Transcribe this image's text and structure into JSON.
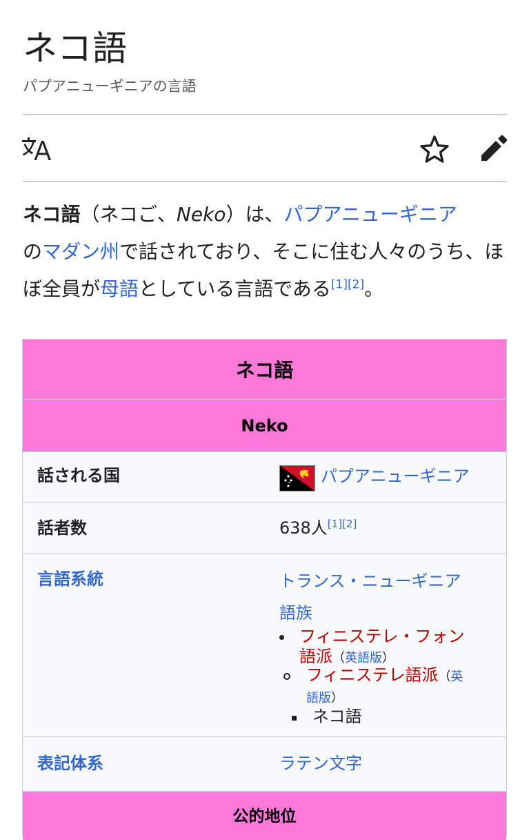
{
  "header": {
    "title": "ネコ語",
    "subtitle": "パプアニューギニアの言語"
  },
  "toolbar": {
    "icons": [
      "language-icon",
      "star-icon",
      "edit-pencil-icon"
    ]
  },
  "lead": {
    "term": "ネコ語",
    "reading": "（ネコご、",
    "romanized": "Neko",
    "after_romanized": "）は、",
    "link_country": "パプアニューギニア",
    "text_no": "の",
    "link_province": "マダン州",
    "text_mid": "で話されており、そこに住む人々のうち、ほぼ全員が",
    "link_mother_tongue": "母語",
    "text_end": "としている言語である",
    "refs": "[1][2]",
    "period": "。"
  },
  "infobox": {
    "title": "ネコ語",
    "native_name": "Neko",
    "rows": {
      "country_label": "話される国",
      "country_value": "パプアニューギニア",
      "speakers_label": "話者数",
      "speakers_value": "638人",
      "speakers_refs": "[1][2]",
      "family_label": "言語系統",
      "family_top_line1": "トランス・ニューギニア",
      "family_top_line2": "語族",
      "family_l1_line1": "フィニステレ・フォン",
      "family_l1_line2": "語派",
      "family_l1_en_open": "（",
      "family_l1_en": "英語版",
      "family_l1_en_close": "）",
      "family_l2": "フィニステレ語派",
      "family_l2_en_open": "（",
      "family_l2_en_a": "英",
      "family_l2_en_b": "語版",
      "family_l2_en_close": "）",
      "family_l3": "ネコ語",
      "script_label": "表記体系",
      "script_value": "ラテン文字"
    },
    "official_status_header": "公的地位"
  },
  "colors": {
    "link": "#3366cc",
    "redlink": "#ba0000",
    "infobox_header": "#ff79da",
    "infobox_bg": "#f8f9fa",
    "divider": "#c8ccd1"
  }
}
